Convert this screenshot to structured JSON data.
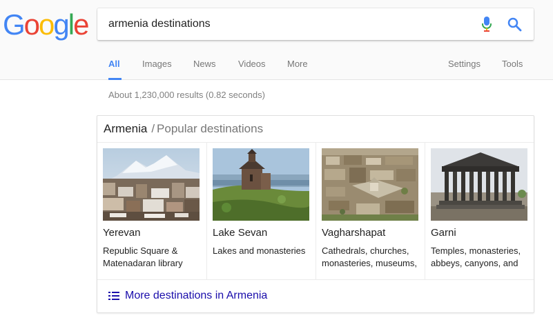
{
  "logo": {
    "letters": [
      "G",
      "o",
      "o",
      "g",
      "l",
      "e"
    ],
    "colors": [
      "#4285f4",
      "#ea4335",
      "#fbbc05",
      "#4285f4",
      "#34a853",
      "#ea4335"
    ]
  },
  "search": {
    "query": "armenia destinations",
    "mic_icon": "microphone-icon",
    "search_icon": "magnifier-icon"
  },
  "tabs": {
    "all": "All",
    "images": "Images",
    "news": "News",
    "videos": "Videos",
    "more": "More",
    "settings": "Settings",
    "tools": "Tools"
  },
  "stats": "About 1,230,000 results (0.82 seconds)",
  "card": {
    "title": "Armenia",
    "separator": "/",
    "subtitle": "Popular destinations",
    "destinations": [
      {
        "name": "Yerevan",
        "description": "Republic Square & Matenadaran library"
      },
      {
        "name": "Lake Sevan",
        "description": "Lakes and monasteries"
      },
      {
        "name": "Vagharshapat",
        "description": "Cathedrals, churches, monasteries, museums,"
      },
      {
        "name": "Garni",
        "description": "Temples, monasteries, abbeys, canyons, and"
      }
    ],
    "more_link": "More destinations in Armenia",
    "more_icon": "list-icon"
  },
  "colors": {
    "accent": "#4285f4",
    "link": "#1a0dab",
    "muted": "#777777"
  }
}
